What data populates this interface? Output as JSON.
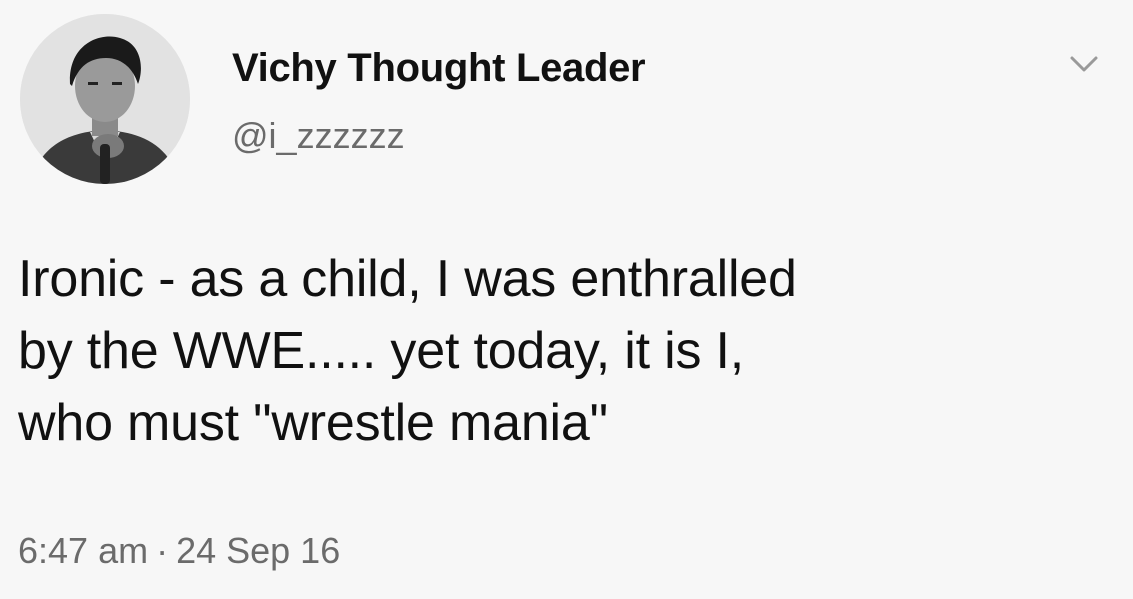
{
  "tweet": {
    "author": {
      "display_name": "Vichy Thought Leader",
      "handle": "@i_zzzzzz",
      "avatar_icon": "profile-photo"
    },
    "menu_icon": "chevron-down-icon",
    "text": "Ironic - as a child, I was enthralled\nby the WWE..... yet today, it is I,\nwho must \"wrestle mania\"",
    "time": "6:47 am",
    "separator": "·",
    "date": "24 Sep 16"
  },
  "colors": {
    "background": "#f7f7f7",
    "text": "#111111",
    "secondary_text": "#6b6b6b"
  }
}
